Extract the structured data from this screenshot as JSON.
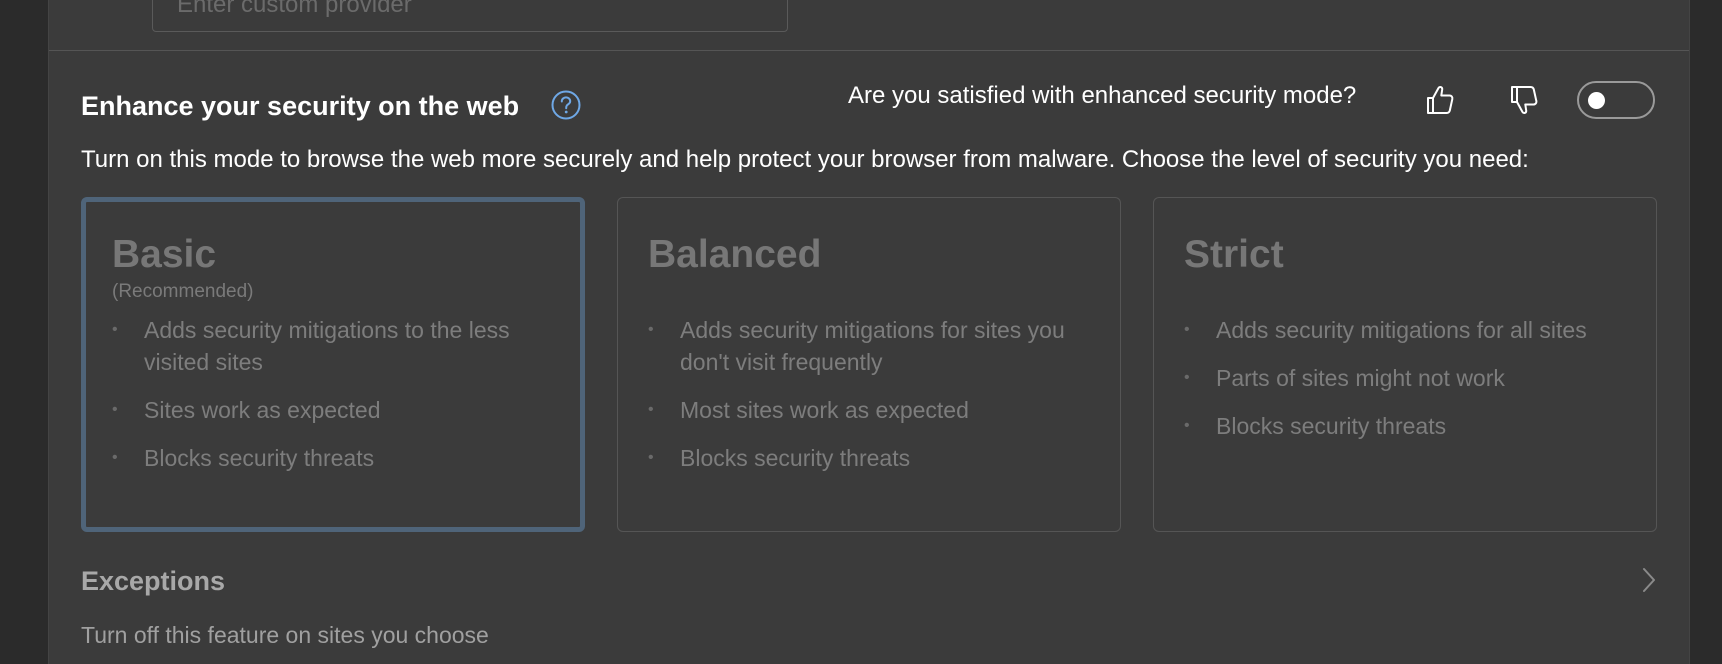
{
  "custom_provider": {
    "placeholder": "Enter custom provider"
  },
  "security": {
    "title": "Enhance your security on the web",
    "help_icon": "help-circle-icon",
    "feedback_question": "Are you satisfied with enhanced security mode?",
    "thumbs_up_icon": "thumbs-up-icon",
    "thumbs_down_icon": "thumbs-down-icon",
    "toggle_on": false,
    "description": "Turn on this mode to browse the web more securely and help protect your browser from malware. Choose the level of security you need:",
    "levels": [
      {
        "title": "Basic",
        "subtitle": "(Recommended)",
        "selected": true,
        "bullets": [
          "Adds security mitigations to the less visited sites",
          "Sites work as expected",
          "Blocks security threats"
        ]
      },
      {
        "title": "Balanced",
        "subtitle": "",
        "selected": false,
        "bullets": [
          "Adds security mitigations for sites you don't visit frequently",
          "Most sites work as expected",
          "Blocks security threats"
        ]
      },
      {
        "title": "Strict",
        "subtitle": "",
        "selected": false,
        "bullets": [
          "Adds security mitigations for all sites",
          "Parts of sites might not work",
          "Blocks security threats"
        ]
      }
    ]
  },
  "exceptions": {
    "title": "Exceptions",
    "description": "Turn off this feature on sites you choose",
    "chevron_icon": "chevron-right-icon"
  },
  "colors": {
    "page_bg": "#2b2b2b",
    "panel_bg": "#3b3b3b",
    "selected_border": "#4f6479",
    "help_icon": "#6fa8e6"
  }
}
